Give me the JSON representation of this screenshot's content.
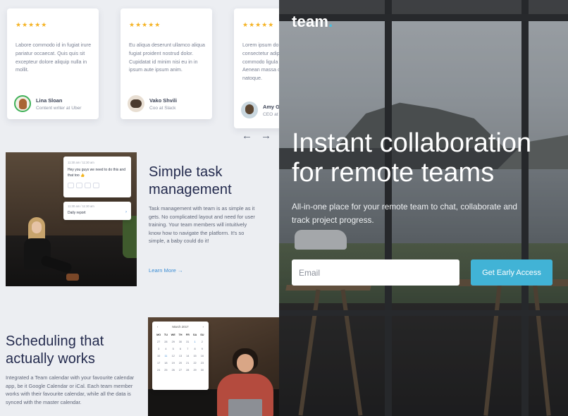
{
  "testimonials": [
    {
      "stars": "★★★★★",
      "quote": "Labore commodo id in fugiat irure pariatur occaecat. Quis quis sit excepteur dolore aliquip nulla in mollit.",
      "name": "Lina Sloan",
      "role": "Content writer at Uber"
    },
    {
      "stars": "★★★★★",
      "quote": "Eu aliqua deserunt ullamco aliqua fugiat proident nostrud dolor. Cupidatat id minim nisi eu in in ipsum aute ipsum anim.",
      "name": "Vako Shvili",
      "role": "Coo at Slack"
    },
    {
      "stars": "★★★★★",
      "quote": "Lorem ipsum dolor sit amet, consectetur adipiscing elit. Ut commodo ligula eget dolor. Aenean massa cum sociis natoque.",
      "name": "Amy Gerald",
      "role": "CEO at Figma"
    }
  ],
  "carousel": {
    "prev": "←",
    "next": "→"
  },
  "feature_tasks": {
    "title": "Simple task management",
    "body": "Task management with team is as simple as it gets. No complicated layout and need for user training. Your team members will intuitively know how to navigate the platform. It's so simple, a baby could do it!",
    "link": "Learn More →",
    "chat_meta": "11:30 am / 11:30 am",
    "chat_msg": "Hey you guys we need to do this and that too 👍",
    "chat2_meta": "11:30 am / 11:30 am",
    "chat2_msg": "Daily report"
  },
  "feature_schedule": {
    "title": "Scheduling that actually works",
    "body": "Integrated  a Team calendar with your favourite calendar app, be it Google Calendar or iCal. Each team member works with their favourite calendar, while all the data is synced with the master calendar.",
    "cal_month": "March 2017",
    "cal_prev": "‹",
    "cal_next": "›",
    "cal_days": [
      "MO",
      "TU",
      "WE",
      "TH",
      "FR",
      "SA",
      "SU"
    ],
    "cal_dates": [
      "27",
      "28",
      "29",
      "30",
      "31",
      "1",
      "2",
      "3",
      "4",
      "5",
      "6",
      "7",
      "8",
      "9",
      "10",
      "11",
      "12",
      "13",
      "14",
      "15",
      "16",
      "17",
      "18",
      "19",
      "20",
      "21",
      "22",
      "23",
      "24",
      "25",
      "26",
      "27",
      "28",
      "29",
      "30"
    ]
  },
  "hero": {
    "logo": "team",
    "logo_dot": ".",
    "title_line1": "Instant collaboration",
    "title_line2": "for remote teams",
    "subtitle": "All-in-one place for your remote team to chat, collaborate and track project progress.",
    "email_placeholder": "Email",
    "cta": "Get Early Access"
  },
  "colors": {
    "accent": "#41b3d6",
    "heading": "#232a4d",
    "link": "#3d8ed4",
    "stars": "#f5b323"
  }
}
